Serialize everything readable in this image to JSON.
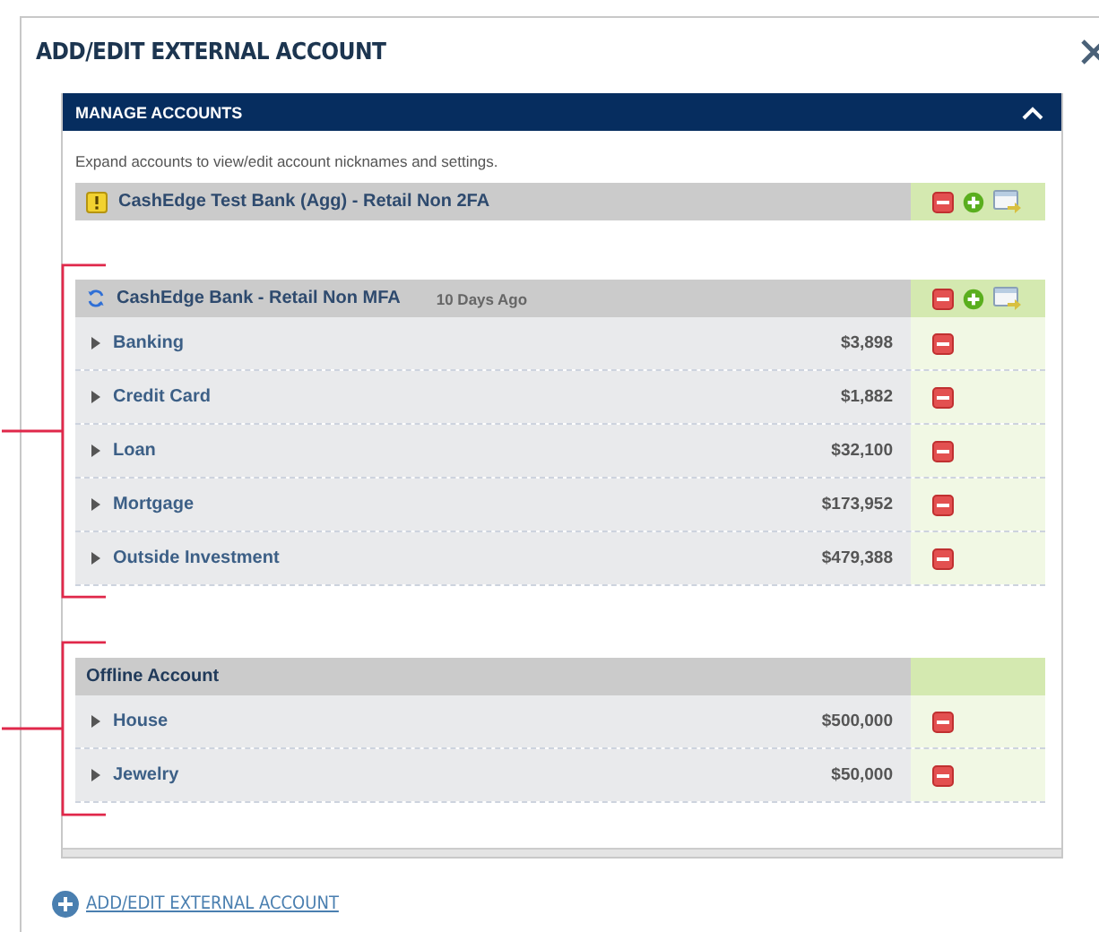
{
  "dialog": {
    "title": "ADD/EDIT EXTERNAL ACCOUNT"
  },
  "panel": {
    "title": "MANAGE ACCOUNTS",
    "expanded": true,
    "description": "Expand accounts to view/edit account nicknames and settings."
  },
  "groups": [
    {
      "kind": "flagged",
      "name": "CashEdge Test Bank (Agg) - Retail Non 2FA"
    },
    {
      "kind": "linked",
      "name": "CashEdge Bank - Retail Non MFA",
      "updated": "10 Days Ago",
      "accounts": [
        {
          "name": "Banking",
          "amount": "$3,898"
        },
        {
          "name": "Credit Card",
          "amount": "$1,882"
        },
        {
          "name": "Loan",
          "amount": "$32,100"
        },
        {
          "name": "Mortgage",
          "amount": "$173,952"
        },
        {
          "name": "Outside Investment",
          "amount": "$479,388"
        }
      ]
    },
    {
      "kind": "offline",
      "name": "Offline Account",
      "accounts": [
        {
          "name": "House",
          "amount": "$500,000"
        },
        {
          "name": "Jewelry",
          "amount": "$50,000"
        }
      ]
    }
  ],
  "footer_link": "ADD/EDIT EXTERNAL ACCOUNT"
}
